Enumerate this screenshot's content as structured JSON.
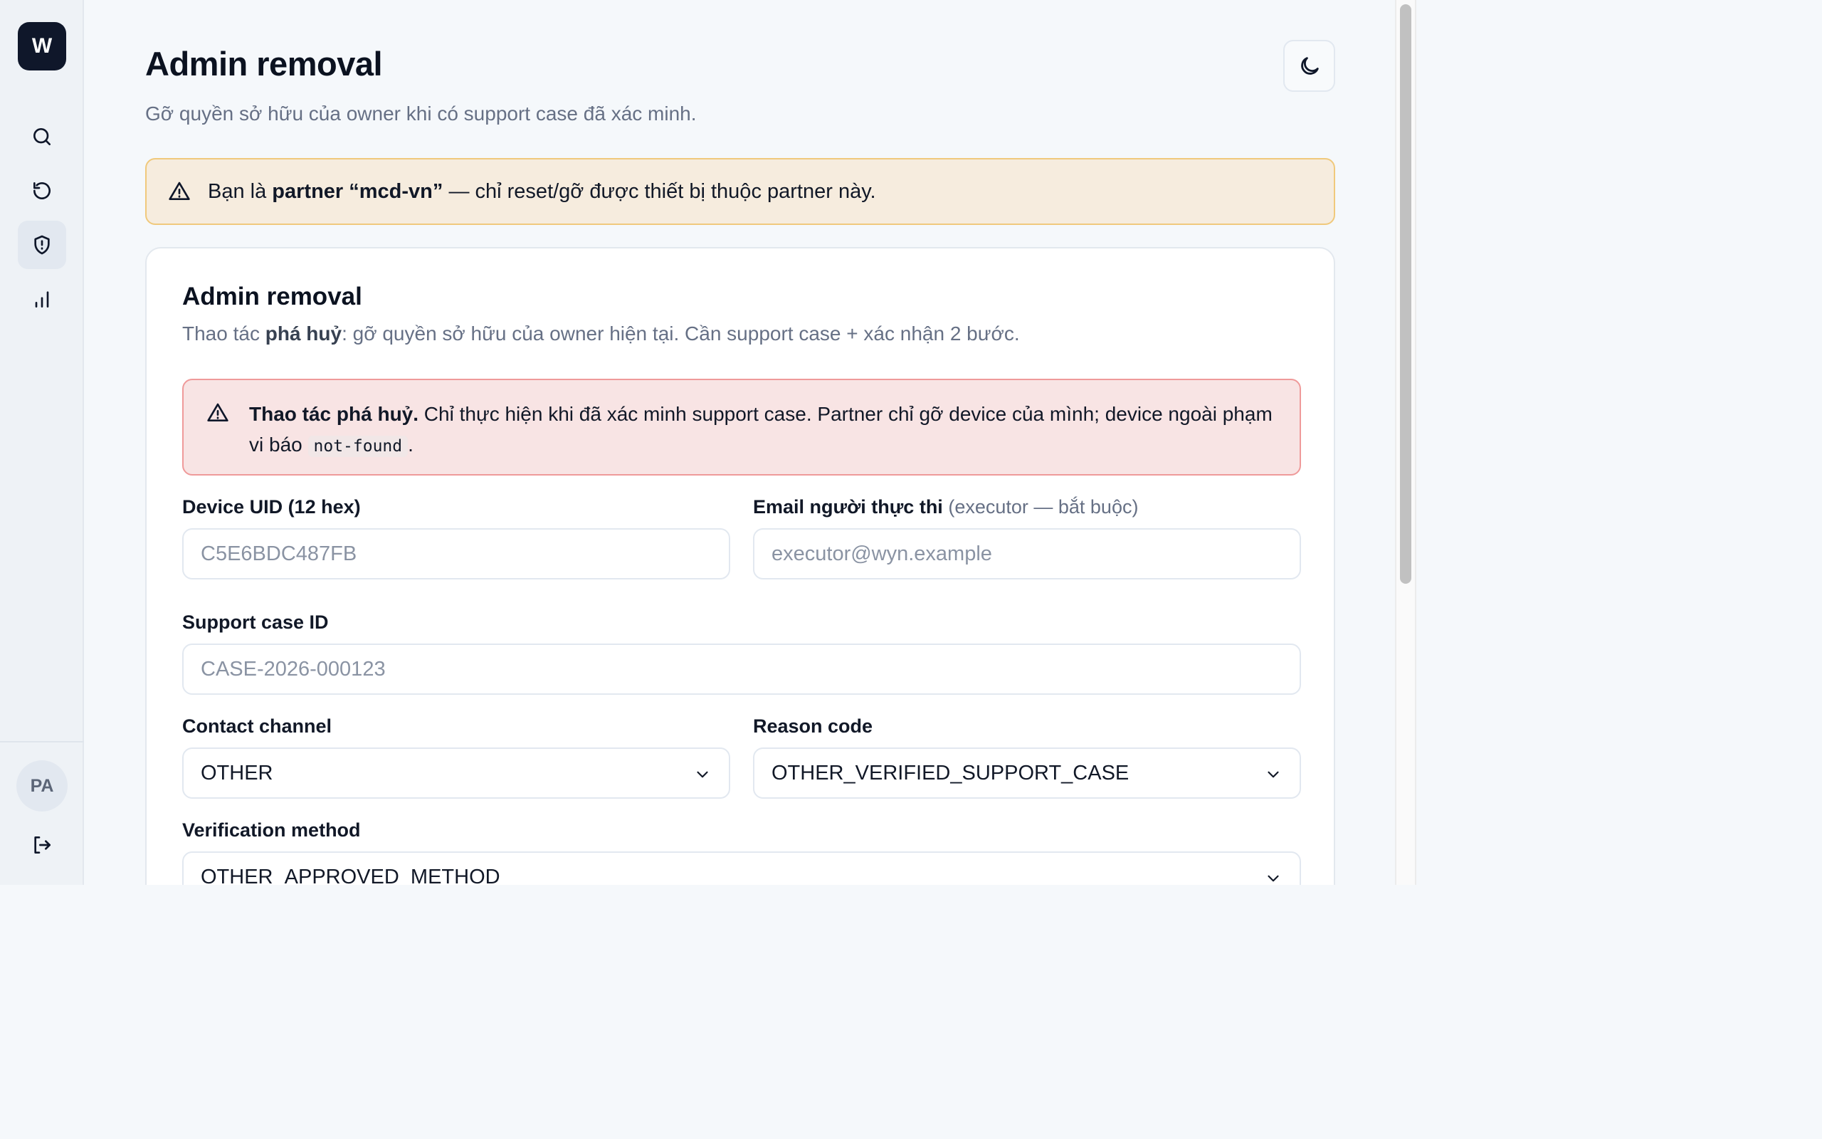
{
  "sidebar": {
    "logo": "W",
    "nav": [
      {
        "icon": "search-icon"
      },
      {
        "icon": "history-icon"
      },
      {
        "icon": "shield-alert-icon",
        "active": true
      },
      {
        "icon": "bar-chart-icon"
      }
    ],
    "avatar": "PA",
    "logout_icon": "logout-icon"
  },
  "header": {
    "title": "Admin removal",
    "subtitle": "Gỡ quyền sở hữu của owner khi có support case đã xác minh.",
    "theme_icon": "moon-icon"
  },
  "partner_banner": {
    "prefix": "Bạn là ",
    "partner": "partner “mcd-vn”",
    "suffix": " — chỉ reset/gỡ được thiết bị thuộc partner này."
  },
  "card": {
    "title": "Admin removal",
    "desc_prefix": "Thao tác ",
    "desc_bold": "phá huỷ",
    "desc_suffix": ": gỡ quyền sở hữu của owner hiện tại. Cần support case + xác nhận 2 bước.",
    "danger": {
      "bold": "Thao tác phá huỷ.",
      "text": " Chỉ thực hiện khi đã xác minh support case. Partner chỉ gỡ device của mình; device ngoài phạm vi báo ",
      "code": "not-found",
      "end": "."
    },
    "fields": {
      "device_uid": {
        "label": "Device UID (12 hex)",
        "placeholder": "C5E6BDC487FB"
      },
      "executor_email": {
        "label": "Email người thực thi",
        "hint": "(executor — bắt buộc)",
        "placeholder": "executor@wyn.example"
      },
      "support_case": {
        "label": "Support case ID",
        "placeholder": "CASE-2026-000123"
      },
      "contact_channel": {
        "label": "Contact channel",
        "value": "OTHER"
      },
      "reason_code": {
        "label": "Reason code",
        "value": "OTHER_VERIFIED_SUPPORT_CASE"
      },
      "verification_method": {
        "label": "Verification method",
        "value": "OTHER_APPROVED_METHOD"
      }
    }
  },
  "colors": {
    "accent": "#0f172a",
    "warning_bg": "#f6ecde",
    "warning_border": "#f0c97c",
    "danger_bg": "#f8e4e4",
    "danger_border": "#ef9a9a"
  }
}
